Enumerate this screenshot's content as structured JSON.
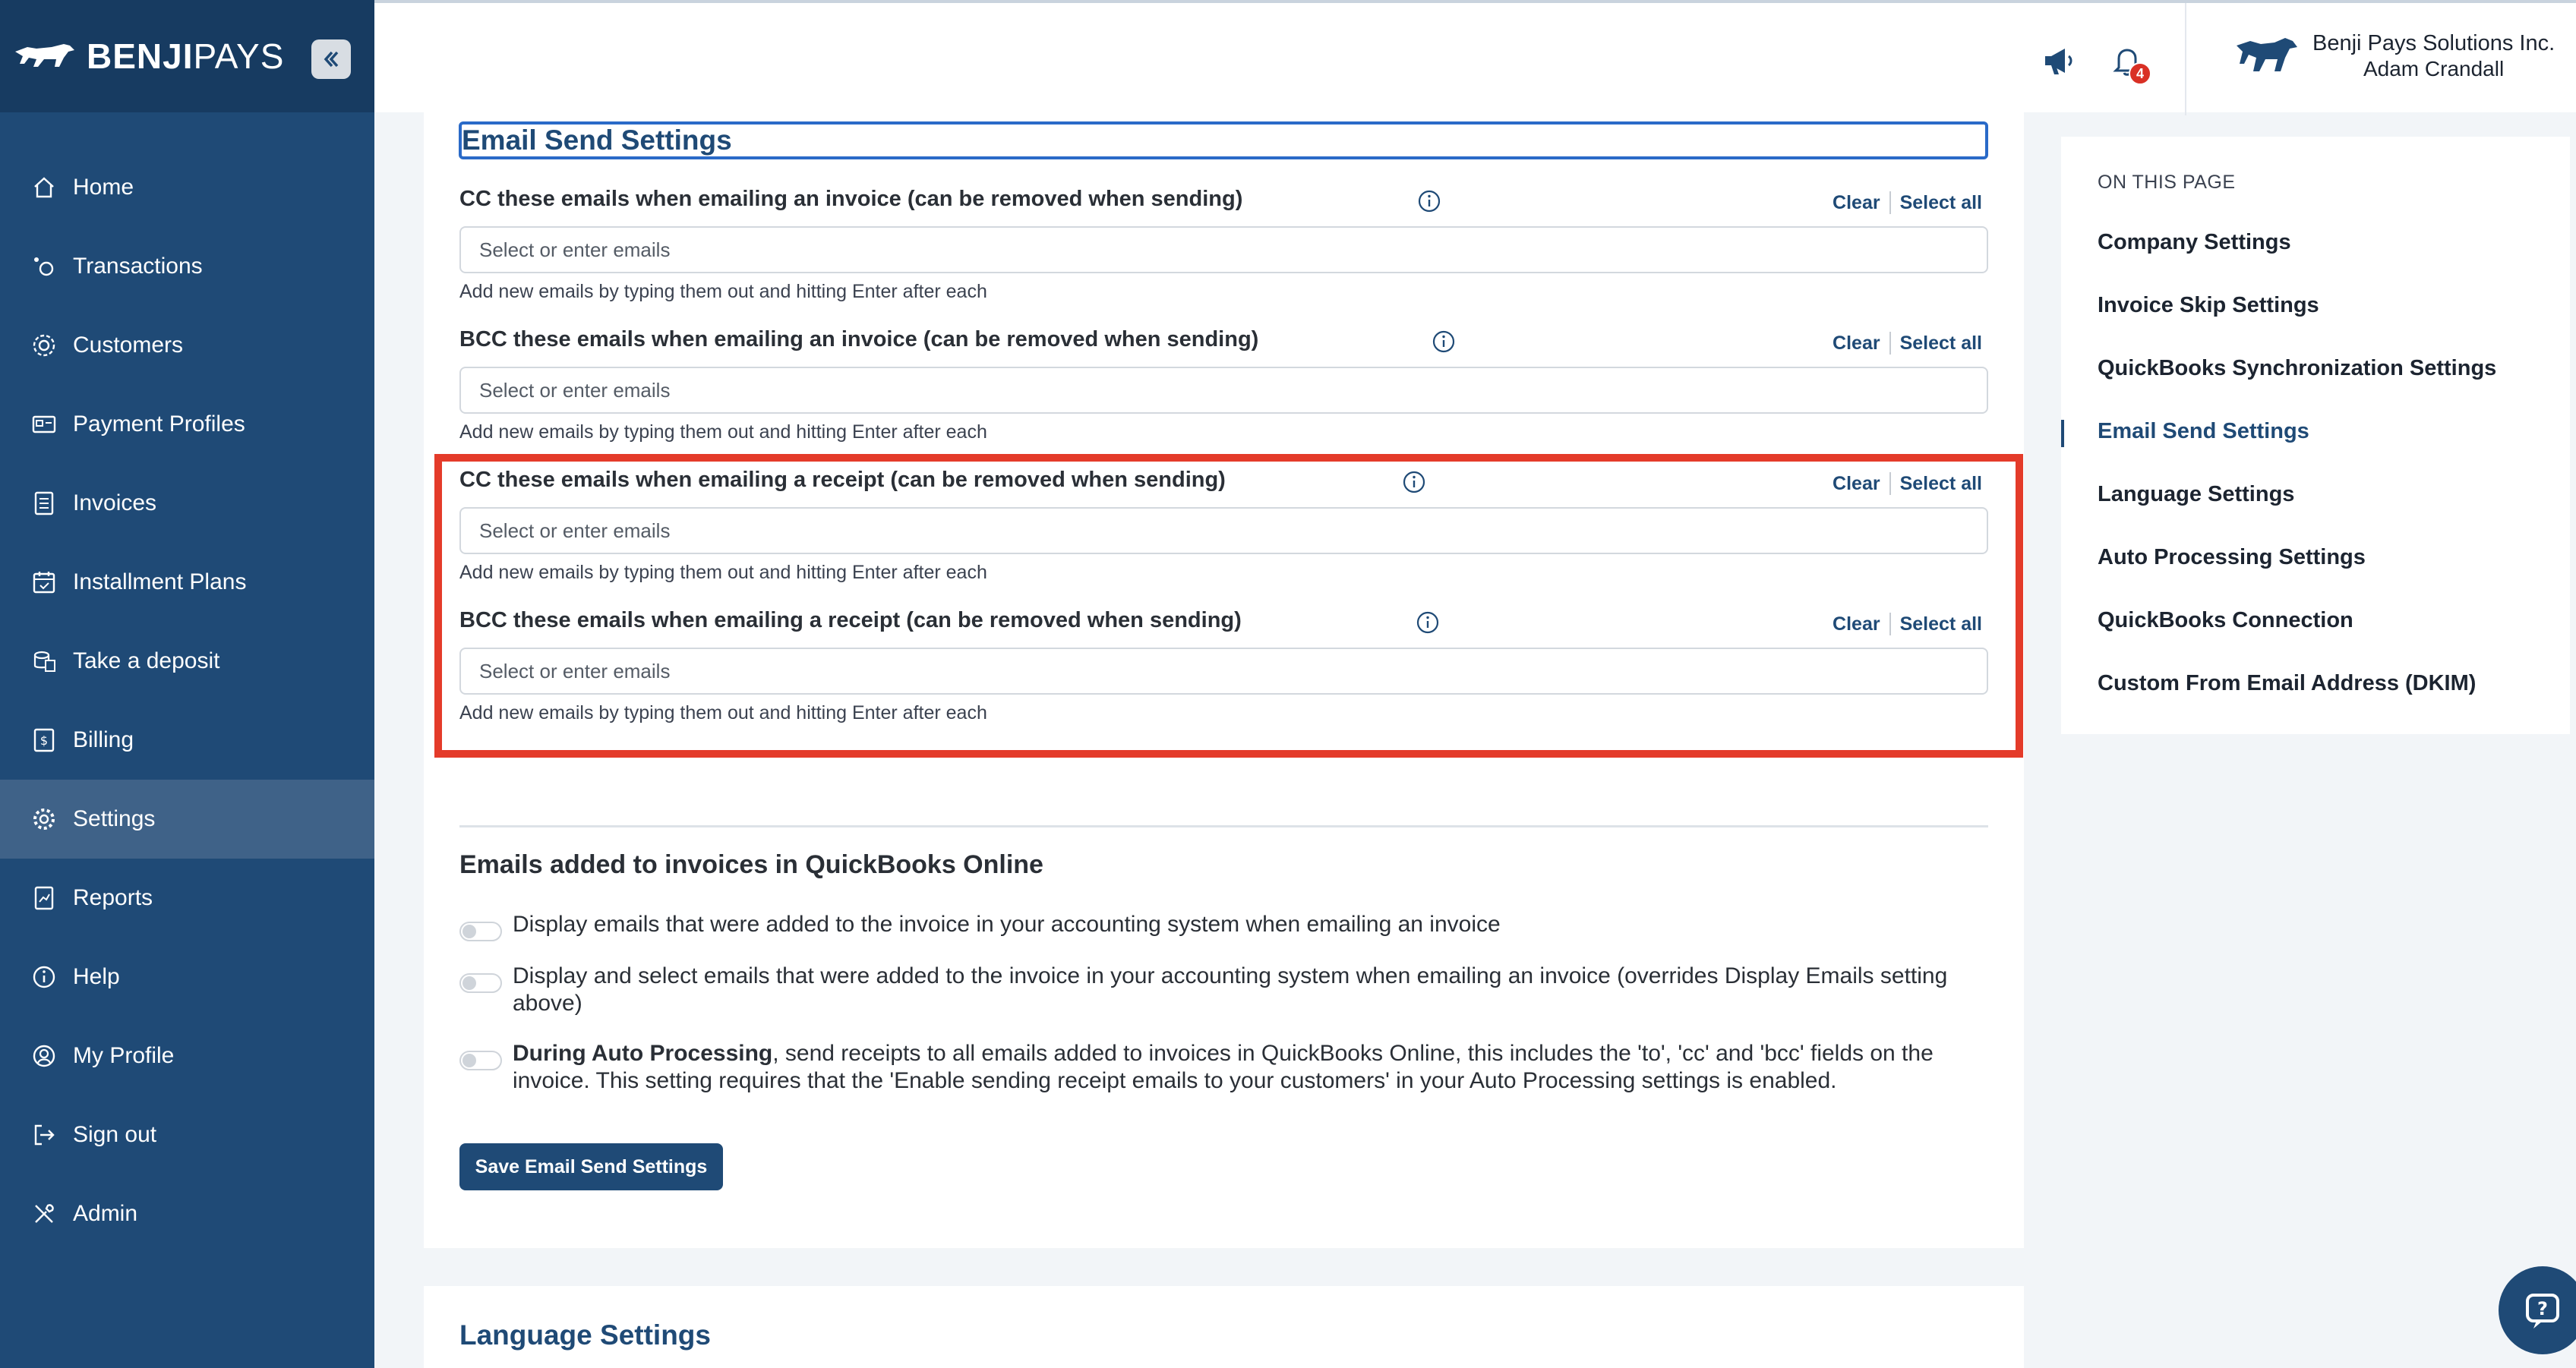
{
  "brand": {
    "logo_bold": "BENJI",
    "logo_light": "PAYS"
  },
  "sidebar": {
    "items": [
      {
        "label": "Home",
        "icon": "home-icon"
      },
      {
        "label": "Transactions",
        "icon": "transactions-icon"
      },
      {
        "label": "Customers",
        "icon": "customers-icon"
      },
      {
        "label": "Payment Profiles",
        "icon": "payment-profiles-icon"
      },
      {
        "label": "Invoices",
        "icon": "invoice-icon"
      },
      {
        "label": "Installment Plans",
        "icon": "calendar-icon"
      },
      {
        "label": "Take a deposit",
        "icon": "deposit-icon"
      },
      {
        "label": "Billing",
        "icon": "billing-icon"
      },
      {
        "label": "Settings",
        "icon": "gear-icon",
        "active": true
      },
      {
        "label": "Reports",
        "icon": "reports-icon"
      },
      {
        "label": "Help",
        "icon": "info-icon"
      },
      {
        "label": "My Profile",
        "icon": "profile-icon"
      },
      {
        "label": "Sign out",
        "icon": "sign-out-icon"
      },
      {
        "label": "Admin",
        "icon": "tools-icon"
      }
    ]
  },
  "topbar": {
    "notification_count": "4",
    "company": "Benji Pays Solutions Inc.",
    "user": "Adam Crandall"
  },
  "email_send": {
    "title": "Email Send Settings",
    "clear_label": "Clear",
    "select_all_label": "Select all",
    "placeholder": "Select or enter emails",
    "help": "Add new emails by typing them out and hitting Enter after each",
    "fields": [
      {
        "label": "CC these emails when emailing an invoice (can be removed when sending)"
      },
      {
        "label": "BCC these emails when emailing an invoice (can be removed when sending)"
      },
      {
        "label": "CC these emails when emailing a receipt (can be removed when sending)"
      },
      {
        "label": "BCC these emails when emailing a receipt (can be removed when sending)"
      }
    ]
  },
  "qbo": {
    "heading": "Emails added to invoices in QuickBooks Online",
    "toggles": [
      {
        "text": "Display emails that were added to the invoice in your accounting system when emailing an invoice"
      },
      {
        "text": "Display and select emails that were added to the invoice in your accounting system when emailing an invoice (overrides Display Emails setting above)"
      },
      {
        "bold": "During Auto Processing",
        "text": ", send receipts to all emails added to invoices in QuickBooks Online, this includes the 'to', 'cc' and 'bcc' fields on the invoice. This setting requires that the 'Enable sending receipt emails to your customers' in your Auto Processing settings is enabled."
      }
    ],
    "save_label": "Save Email Send Settings"
  },
  "language": {
    "title": "Language Settings"
  },
  "toc": {
    "heading": "ON THIS PAGE",
    "items": [
      "Company Settings",
      "Invoice Skip Settings",
      "QuickBooks Synchronization Settings",
      "Email Send Settings",
      "Language Settings",
      "Auto Processing Settings",
      "QuickBooks Connection",
      "Custom From Email Address (DKIM)"
    ],
    "active": "Email Send Settings"
  },
  "colors": {
    "primary": "#1f4a76",
    "highlight": "#e43b2a",
    "badge": "#d93025"
  }
}
